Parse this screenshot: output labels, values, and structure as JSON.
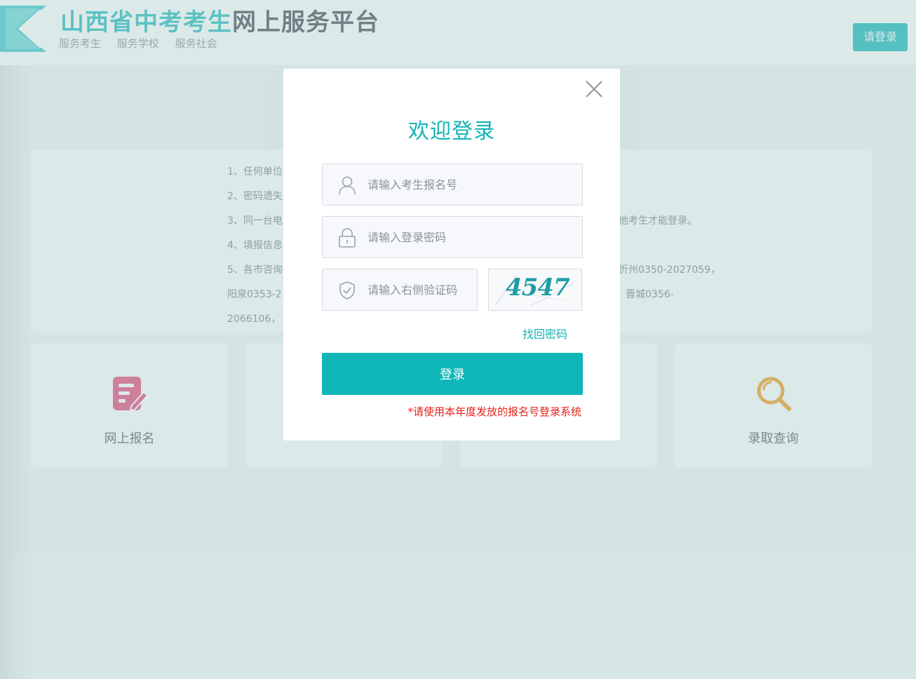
{
  "header": {
    "title_highlight": "山西省中考考生",
    "title_rest": "网上服务平台",
    "subnav": [
      "服务考生",
      "服务学校",
      "服务社会"
    ],
    "login_button": "请登录"
  },
  "notice": {
    "lines": [
      "1、任何单位",
      "2、密码遗失",
      "3、同一台电",
      "他考生才能登录。",
      "4、填报信息",
      "5、各市咨询",
      "忻州0350-2027059，",
      "阳泉0353-2",
      "晋城0356-",
      "2066106，"
    ]
  },
  "cards": [
    {
      "label": "网上报名",
      "icon": "edit-form-icon",
      "color": "#e7477d"
    },
    {
      "label": "",
      "icon": "",
      "color": ""
    },
    {
      "label": "",
      "icon": "",
      "color": ""
    },
    {
      "label": "录取查询",
      "icon": "search-icon",
      "color": "#f39a1e"
    }
  ],
  "modal": {
    "title": "欢迎登录",
    "username_placeholder": "请输入考生报名号",
    "password_placeholder": "请输入登录密码",
    "captcha_placeholder": "请输入右侧验证码",
    "captcha_text": "4547",
    "forgot_link": "找回密码",
    "submit_label": "登录",
    "tip": "*请使用本年度发放的报名号登录系统"
  },
  "colors": {
    "accent": "#12b4b7",
    "warning": "#e3231a"
  }
}
